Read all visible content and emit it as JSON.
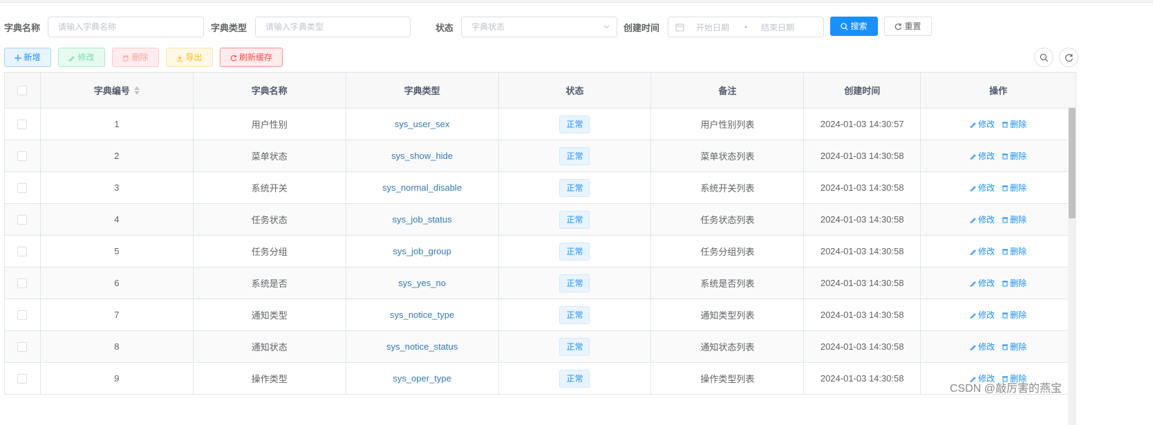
{
  "search": {
    "dict_name_label": "字典名称",
    "dict_name_placeholder": "请输入字典名称",
    "dict_type_label": "字典类型",
    "dict_type_placeholder": "请输入字典类型",
    "status_label": "状态",
    "status_placeholder": "字典状态",
    "created_label": "创建时间",
    "start_date_placeholder": "开始日期",
    "range_separator": "-",
    "end_date_placeholder": "结束日期",
    "search_button": "搜索",
    "reset_button": "重置"
  },
  "toolbar": {
    "add": "新增",
    "edit": "修改",
    "delete": "删除",
    "export": "导出",
    "refresh_cache": "刷新缓存"
  },
  "table": {
    "columns": [
      "字典编号",
      "字典名称",
      "字典类型",
      "状态",
      "备注",
      "创建时间",
      "操作"
    ],
    "rows": [
      {
        "id": "1",
        "name": "用户性别",
        "type": "sys_user_sex",
        "status": "正常",
        "remark": "用户性别列表",
        "created": "2024-01-03 14:30:57"
      },
      {
        "id": "2",
        "name": "菜单状态",
        "type": "sys_show_hide",
        "status": "正常",
        "remark": "菜单状态列表",
        "created": "2024-01-03 14:30:58"
      },
      {
        "id": "3",
        "name": "系统开关",
        "type": "sys_normal_disable",
        "status": "正常",
        "remark": "系统开关列表",
        "created": "2024-01-03 14:30:58"
      },
      {
        "id": "4",
        "name": "任务状态",
        "type": "sys_job_status",
        "status": "正常",
        "remark": "任务状态列表",
        "created": "2024-01-03 14:30:58"
      },
      {
        "id": "5",
        "name": "任务分组",
        "type": "sys_job_group",
        "status": "正常",
        "remark": "任务分组列表",
        "created": "2024-01-03 14:30:58"
      },
      {
        "id": "6",
        "name": "系统是否",
        "type": "sys_yes_no",
        "status": "正常",
        "remark": "系统是否列表",
        "created": "2024-01-03 14:30:58"
      },
      {
        "id": "7",
        "name": "通知类型",
        "type": "sys_notice_type",
        "status": "正常",
        "remark": "通知类型列表",
        "created": "2024-01-03 14:30:58"
      },
      {
        "id": "8",
        "name": "通知状态",
        "type": "sys_notice_status",
        "status": "正常",
        "remark": "通知状态列表",
        "created": "2024-01-03 14:30:58"
      },
      {
        "id": "9",
        "name": "操作类型",
        "type": "sys_oper_type",
        "status": "正常",
        "remark": "操作类型列表",
        "created": "2024-01-03 14:30:58"
      }
    ],
    "row_edit": "修改",
    "row_delete": "删除"
  },
  "watermark": "CSDN @敲厉害的燕宝",
  "colors": {
    "primary": "#1890ff",
    "success_light": "#71e2a3",
    "danger_light": "#ffa2a2",
    "warning": "#ffba00",
    "danger": "#ff4949",
    "link": "#337ab7"
  }
}
